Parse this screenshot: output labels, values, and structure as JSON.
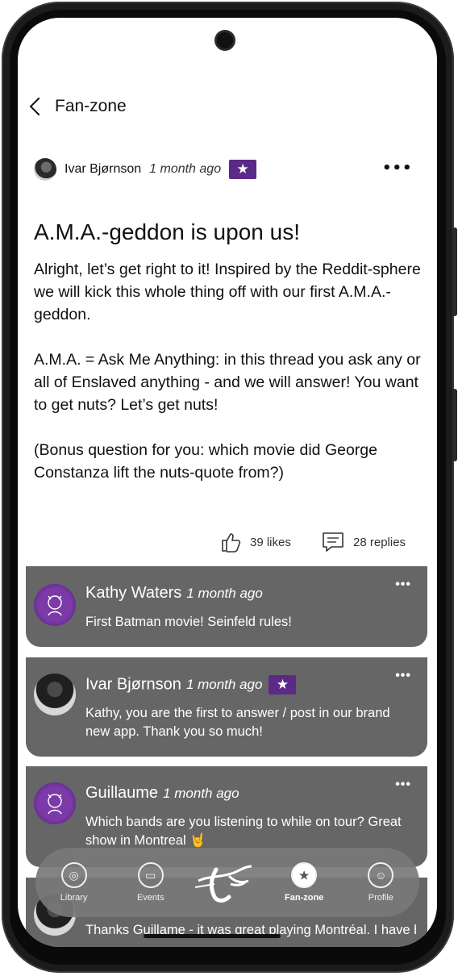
{
  "nav": {
    "back_label": "Fan-zone"
  },
  "post": {
    "author": "Ivar Bjørnson",
    "time": "1 month ago",
    "title": "A.M.A.-geddon is upon us!",
    "paragraphs": [
      "Alright, let’s get right to it! Inspired by the Reddit-sphere we will kick this whole thing off with our first A.M.A.-geddon.",
      "A.M.A. = Ask Me Anything: in this thread you ask any or all of Enslaved anything - and we will answer! You want to get nuts? Let’s get nuts!",
      "(Bonus question for you: which movie did George Constanza lift the nuts-quote from?)"
    ],
    "likes": "39 likes",
    "replies": "28 replies"
  },
  "replies": [
    {
      "name": "Kathy Waters",
      "time": "1 month ago",
      "text": "First Batman movie! Seinfeld rules!"
    },
    {
      "name": "Ivar Bjørnson",
      "time": "1 month ago",
      "text": "Kathy,  you are the first to answer / post in our brand new app. Thank you so much!"
    },
    {
      "name": "Guillaume",
      "time": "1 month ago",
      "text": "Which bands are you listening to while on tour? Great show in Montreal 🤘"
    },
    {
      "name": "",
      "time": "",
      "text": "Thanks Guillame - it was great playing Montréal. I have been listening to a lot of the classic table f"
    }
  ],
  "bottom_nav": [
    {
      "label": "Library",
      "icon": "vinyl-icon"
    },
    {
      "label": "Events",
      "icon": "ticket-icon"
    },
    {
      "label": "Fan-zone",
      "icon": "chat-star-icon"
    },
    {
      "label": "Profile",
      "icon": "profile-icon"
    }
  ],
  "colors": {
    "card_bg": "#666666",
    "badge": "#5b2a86",
    "avatar_purple": "#7b3aa8"
  }
}
